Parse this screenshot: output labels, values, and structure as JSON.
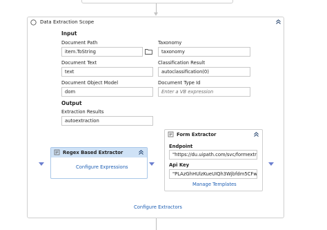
{
  "scope": {
    "title": "Data Extraction Scope",
    "input_label": "Input",
    "output_label": "Output",
    "configure_extractors": "Configure Extractors",
    "fields": {
      "document_path": {
        "label": "Document Path",
        "value": "item.ToString"
      },
      "taxonomy": {
        "label": "Taxonomy",
        "value": "taxonomy"
      },
      "document_text": {
        "label": "Document Text",
        "value": "text"
      },
      "classification_result": {
        "label": "Classification Result",
        "value": "autoclassification(0)"
      },
      "document_object_model": {
        "label": "Document Object Model",
        "value": "dom"
      },
      "document_type_id": {
        "label": "Document Type Id",
        "placeholder": "Enter a VB expression"
      },
      "extraction_results": {
        "label": "Extraction Results",
        "value": "autoextraction"
      }
    }
  },
  "regex_extractor": {
    "title": "Regex Based Extractor",
    "configure_link": "Configure Expressions"
  },
  "form_extractor": {
    "title": "Form Extractor",
    "endpoint_label": "Endpoint",
    "endpoint_value": "\"https://du.uipath.com/svc/formextra",
    "apikey_label": "Api Key",
    "apikey_value": "\"PLAzGhHUlzKueUIQh3Wjbfdm5CFw/",
    "manage_templates": "Manage Templates"
  },
  "icons": [
    "scope-status-icon",
    "collapse-chevron-icon",
    "folder-icon",
    "regex-extractor-icon",
    "form-extractor-icon",
    "expand-triangle-icon"
  ],
  "colors": {
    "link": "#1e5fb4",
    "selected_header": "#cfe2f6",
    "triangle": "#6b7fcf"
  }
}
